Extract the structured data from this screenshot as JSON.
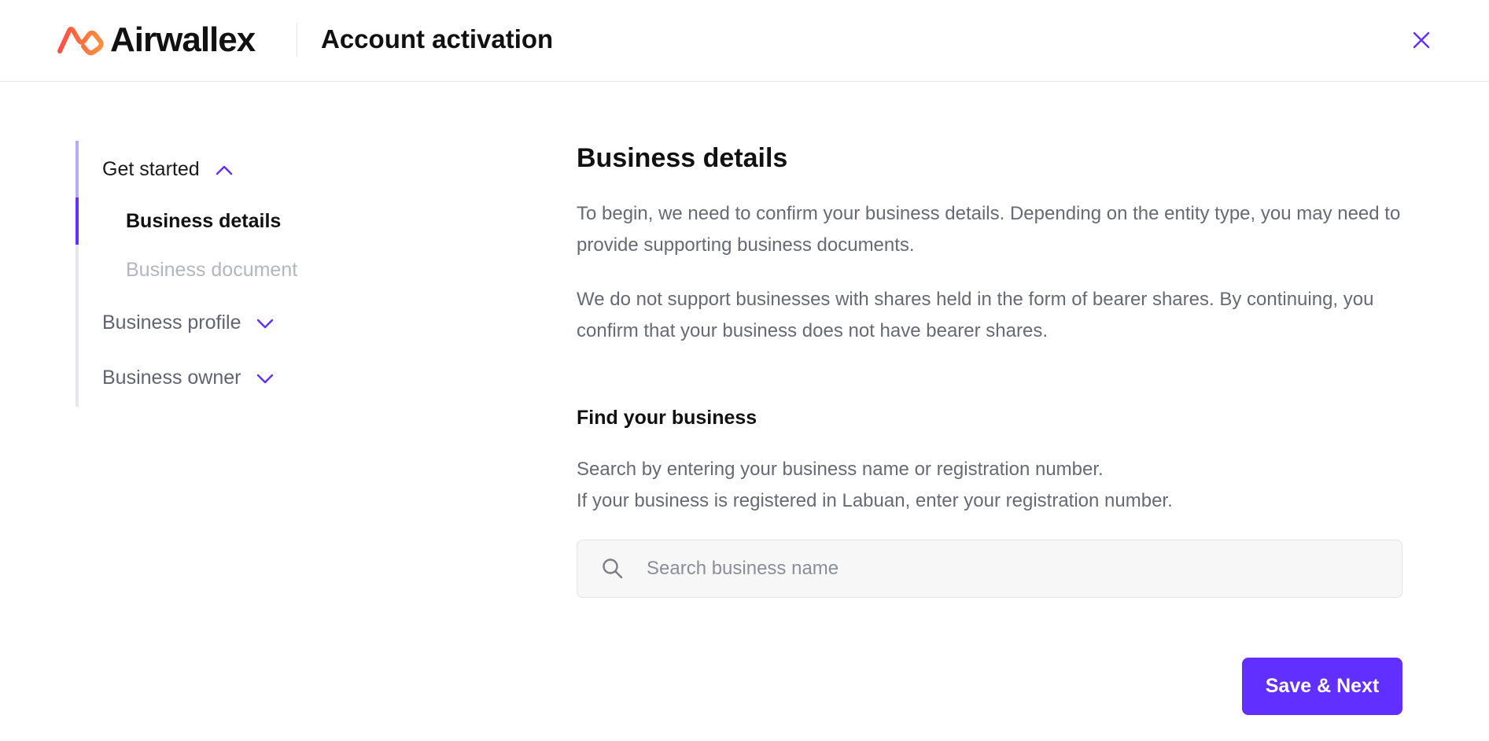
{
  "header": {
    "logo_text": "Airwallex",
    "title": "Account activation",
    "close_icon": "close-icon"
  },
  "sidebar": {
    "sections": [
      {
        "label": "Get started",
        "expanded": true,
        "icon": "chevron-up-icon",
        "items": [
          {
            "label": "Business details",
            "state": "active"
          },
          {
            "label": "Business document",
            "state": "disabled"
          }
        ]
      },
      {
        "label": "Business profile",
        "expanded": false,
        "icon": "chevron-down-icon"
      },
      {
        "label": "Business owner",
        "expanded": false,
        "icon": "chevron-down-icon"
      }
    ]
  },
  "main": {
    "title": "Business details",
    "intro_1": "To begin, we need to confirm your business details. Depending on the entity type, you may need to provide supporting business documents.",
    "intro_2": "We do not support businesses with shares held in the form of bearer shares. By continuing, you confirm that your business does not have bearer shares.",
    "find_title": "Find your business",
    "find_help_1": "Search by entering your business name or registration number.",
    "find_help_2": "If your business is registered in Labuan, enter your registration number.",
    "search": {
      "placeholder": "Search business name",
      "value": ""
    },
    "save_label": "Save & Next"
  },
  "colors": {
    "accent": "#612fff",
    "brand_orange": "#ff4f42",
    "muted_text": "#676a73",
    "disabled_text": "#b4b6bd"
  }
}
